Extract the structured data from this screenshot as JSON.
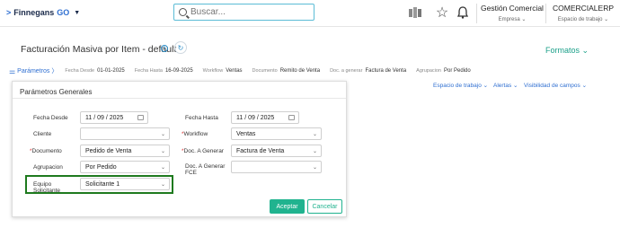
{
  "topbar": {
    "logo_text": "Finnegans",
    "logo_suffix": "GO",
    "search_placeholder": "Buscar...",
    "company_name": "Gestión Comercial",
    "company_sub": "Empresa",
    "workspace_name": "COMERCIALERP",
    "workspace_sub": "Espacio de trabajo"
  },
  "page": {
    "title": "Facturación Masiva por Item - default",
    "formatos_label": "Formatos"
  },
  "filterbar": {
    "params_label": "Parámetros",
    "items": [
      {
        "label": "Fecha Desde",
        "value": "01-01-2025"
      },
      {
        "label": "Fecha Hasta",
        "value": "16-09-2025"
      },
      {
        "label": "Workflow",
        "value": "Ventas"
      },
      {
        "label": "Documento",
        "value": "Remito de Venta"
      },
      {
        "label": "Doc. a generar",
        "value": "Factura de Venta"
      },
      {
        "label": "Agrupacion",
        "value": "Por Pedido"
      }
    ]
  },
  "links": {
    "workspace": "Espacio de trabajo",
    "alerts": "Alertas",
    "fields_visibility": "Visibilidad de campos"
  },
  "panel": {
    "title": "Parámetros Generales",
    "fecha_desde_label": "Fecha Desde",
    "fecha_desde_value": "11 / 09 / 2025",
    "fecha_hasta_label": "Fecha Hasta",
    "fecha_hasta_value": "11 / 09 / 2025",
    "cliente_label": "Cliente",
    "cliente_value": "",
    "workflow_label": "Workflow",
    "workflow_value": "Ventas",
    "documento_label": "Documento",
    "documento_value": "Pedido de Venta",
    "doc_generar_label": "Doc. A Generar",
    "doc_generar_value": "Factura de Venta",
    "agrupacion_label": "Agrupacion",
    "agrupacion_value": "Por Pedido",
    "doc_generar_fce_label_1": "Doc. A Generar",
    "doc_generar_fce_label_2": "FCE",
    "doc_generar_fce_value": "",
    "equipo_label_1": "Equipo",
    "equipo_label_2": "Solicitante",
    "equipo_value": "Solicitante 1",
    "accept_label": "Aceptar",
    "cancel_label": "Cancelar",
    "required_mark": "*"
  },
  "colors": {
    "accent": "#20b38f",
    "link": "#2f6fd1",
    "highlight": "#1e7a1e"
  }
}
